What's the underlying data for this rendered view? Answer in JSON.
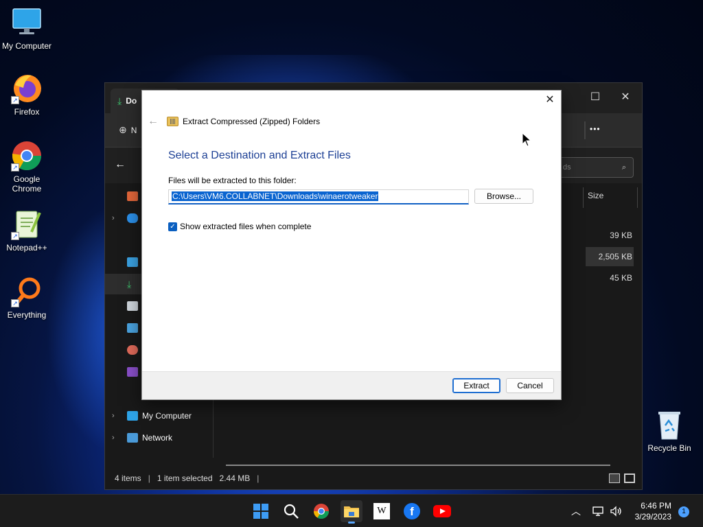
{
  "desktop": {
    "icons": [
      {
        "label": "My Computer"
      },
      {
        "label": "Firefox"
      },
      {
        "label": "Google\nChrome"
      },
      {
        "label": "Notepad++"
      },
      {
        "label": "Everything"
      },
      {
        "label": "Recycle Bin"
      }
    ]
  },
  "explorer": {
    "tab_title": "Do",
    "toolbar_new_label": "N",
    "toolbar_more_label": "•••",
    "search_placeholder": "ds",
    "column_size_header": "Size",
    "nav": {
      "my_computer": "My Computer",
      "network": "Network"
    },
    "file_sizes": [
      "39 KB",
      "2,505 KB",
      "45 KB"
    ],
    "status": {
      "items": "4 items",
      "separator": "|",
      "selected": "1 item selected",
      "size": "2.44 MB"
    }
  },
  "dialog": {
    "title": "Extract Compressed (Zipped) Folders",
    "heading": "Select a Destination and Extract Files",
    "folder_label": "Files will be extracted to this folder:",
    "path_value": "C:\\Users\\VM6.COLLABNET\\Downloads\\winaerotweaker",
    "browse_label": "Browse...",
    "show_files_label": "Show extracted files when complete",
    "show_files_checked": true,
    "extract_label": "Extract",
    "cancel_label": "Cancel",
    "close_glyph": "✕",
    "back_glyph": "←"
  },
  "taskbar": {
    "apps": [
      "start-icon",
      "search-icon",
      "chrome-icon",
      "file-explorer-icon",
      "wikipedia-icon",
      "facebook-icon",
      "youtube-icon"
    ],
    "time": "6:46 PM",
    "date": "3/29/2023",
    "notifications": "1"
  },
  "colors": {
    "accent": "#0a64d0",
    "dialog_heading": "#1c3f94"
  }
}
